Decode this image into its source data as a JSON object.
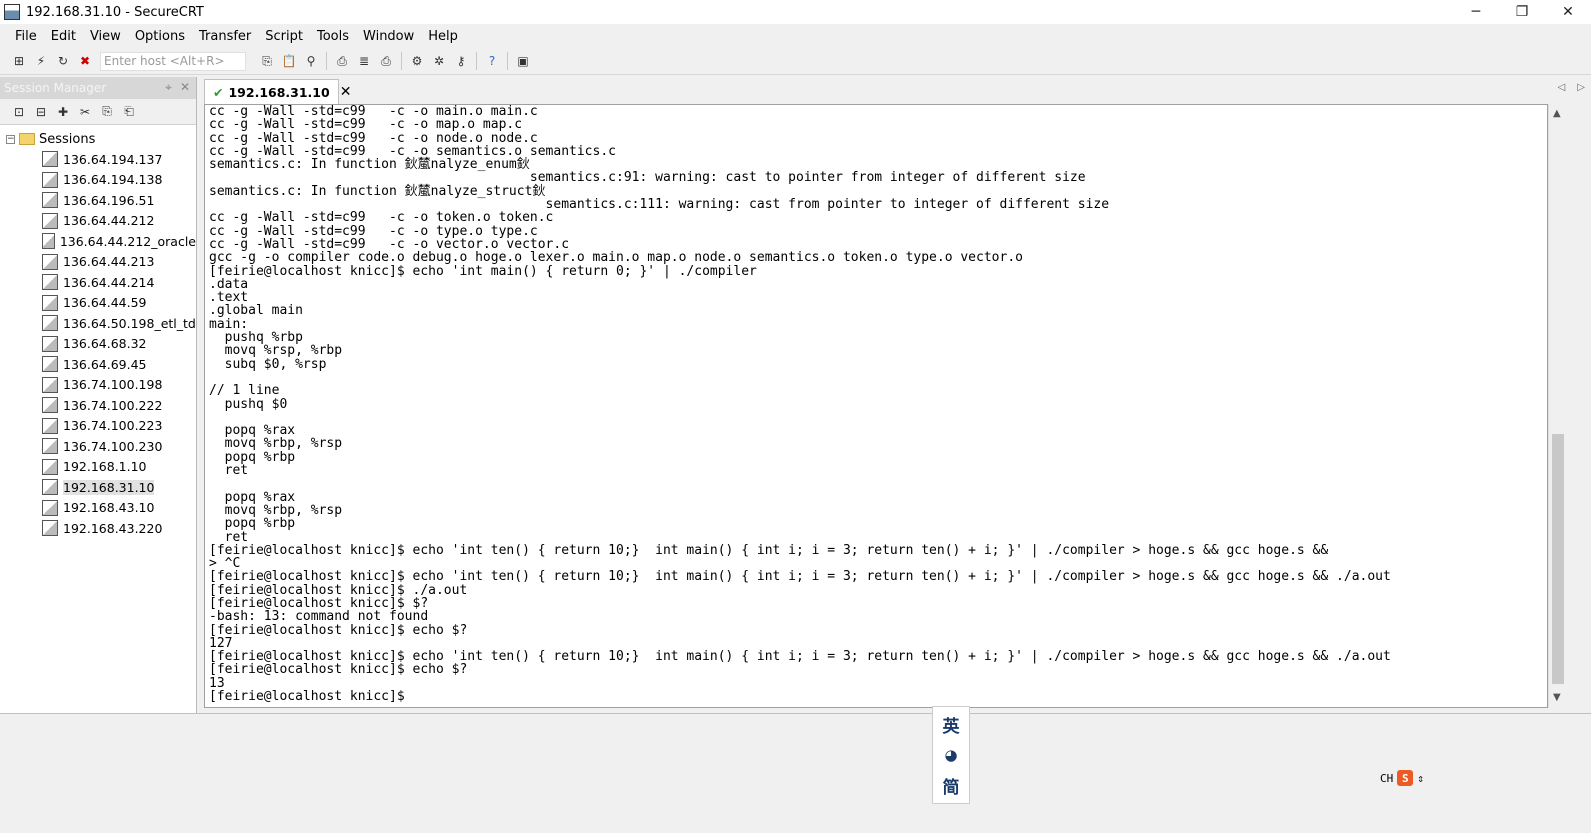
{
  "window": {
    "title": "192.168.31.10 - SecureCRT",
    "minimize": "─",
    "restore": "❐",
    "close": "✕"
  },
  "menu": [
    "File",
    "Edit",
    "View",
    "Options",
    "Transfer",
    "Script",
    "Tools",
    "Window",
    "Help"
  ],
  "toolbar": {
    "host_placeholder": "Enter host <Alt+R>"
  },
  "session_manager": {
    "title": "Session Manager",
    "pin": "⌖",
    "close": "✕",
    "root": "Sessions",
    "root_expander": "−",
    "items": [
      "136.64.194.137",
      "136.64.194.138",
      "136.64.196.51",
      "136.64.44.212",
      "136.64.44.212_oracle",
      "136.64.44.213",
      "136.64.44.214",
      "136.64.44.59",
      "136.64.50.198_etl_td",
      "136.64.68.32",
      "136.64.69.45",
      "136.74.100.198",
      "136.74.100.222",
      "136.74.100.223",
      "136.74.100.230",
      "192.168.1.10",
      "192.168.31.10",
      "192.168.43.10",
      "192.168.43.220"
    ],
    "selected": "192.168.31.10"
  },
  "tab": {
    "check": "✔",
    "label": "192.168.31.10",
    "close": "✕",
    "nav_left": "◁",
    "nav_right": "▷"
  },
  "terminal": {
    "lines": [
      "cc -g -Wall -std=c99   -c -o main.o main.c",
      "cc -g -Wall -std=c99   -c -o map.o map.c",
      "cc -g -Wall -std=c99   -c -o node.o node.c",
      "cc -g -Wall -std=c99   -c -o semantics.o semantics.c",
      "semantics.c: In function 鈥檒nalyze_enum鈥",
      "                                         semantics.c:91: warning: cast to pointer from integer of different size",
      "semantics.c: In function 鈥檒nalyze_struct鈥",
      "                                           semantics.c:111: warning: cast from pointer to integer of different size",
      "cc -g -Wall -std=c99   -c -o token.o token.c",
      "cc -g -Wall -std=c99   -c -o type.o type.c",
      "cc -g -Wall -std=c99   -c -o vector.o vector.c",
      "gcc -g -o compiler code.o debug.o hoge.o lexer.o main.o map.o node.o semantics.o token.o type.o vector.o",
      "[feirie@localhost knicc]$ echo 'int main() { return 0; }' | ./compiler",
      ".data",
      ".text",
      ".global main",
      "main:",
      "  pushq %rbp",
      "  movq %rsp, %rbp",
      "  subq $0, %rsp",
      "",
      "// 1 line",
      "  pushq $0",
      "",
      "  popq %rax",
      "  movq %rbp, %rsp",
      "  popq %rbp",
      "  ret",
      "",
      "  popq %rax",
      "  movq %rbp, %rsp",
      "  popq %rbp",
      "  ret",
      "[feirie@localhost knicc]$ echo 'int ten() { return 10;}  int main() { int i; i = 3; return ten() + i; }' | ./compiler > hoge.s && gcc hoge.s &&",
      "> ^C",
      "[feirie@localhost knicc]$ echo 'int ten() { return 10;}  int main() { int i; i = 3; return ten() + i; }' | ./compiler > hoge.s && gcc hoge.s && ./a.out",
      "[feirie@localhost knicc]$ ./a.out",
      "[feirie@localhost knicc]$ $?",
      "-bash: 13: command not found",
      "[feirie@localhost knicc]$ echo $?",
      "127",
      "[feirie@localhost knicc]$ echo 'int ten() { return 10;}  int main() { int i; i = 3; return ten() + i; }' | ./compiler > hoge.s && gcc hoge.s && ./a.out",
      "[feirie@localhost knicc]$ echo $?",
      "13",
      "[feirie@localhost knicc]$ "
    ]
  },
  "scroll": {
    "up": "▲",
    "down": "▼"
  },
  "ime": {
    "mode": "英",
    "moon": "◕",
    "simplified": "简",
    "indicator": "CH",
    "logo": "S",
    "arrows": "⇕"
  }
}
